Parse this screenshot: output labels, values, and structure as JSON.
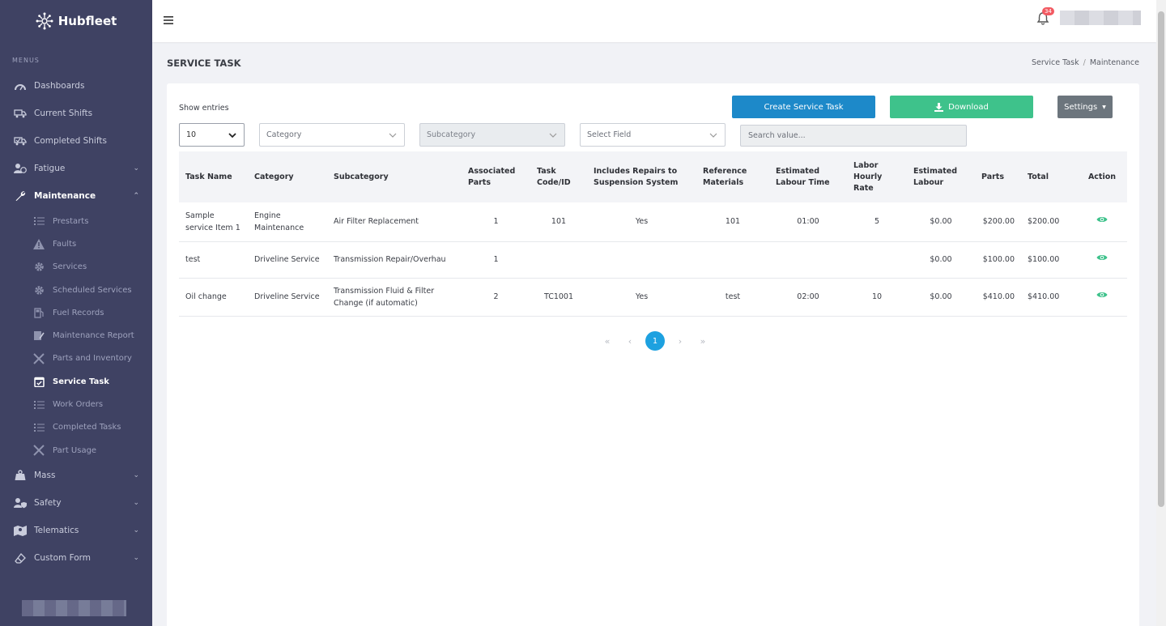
{
  "brand": {
    "name": "Hubfleet"
  },
  "sidebar": {
    "menu_title": "MENUS",
    "items": [
      {
        "label": "Dashboards"
      },
      {
        "label": "Current Shifts"
      },
      {
        "label": "Completed Shifts"
      },
      {
        "label": "Fatigue"
      },
      {
        "label": "Maintenance"
      },
      {
        "label": "Mass"
      },
      {
        "label": "Safety"
      },
      {
        "label": "Telematics"
      },
      {
        "label": "Custom Form"
      }
    ],
    "maintenance_sub": [
      {
        "label": "Prestarts"
      },
      {
        "label": "Faults"
      },
      {
        "label": "Services"
      },
      {
        "label": "Scheduled Services"
      },
      {
        "label": "Fuel Records"
      },
      {
        "label": "Maintenance Report"
      },
      {
        "label": "Parts and Inventory"
      },
      {
        "label": "Service Task"
      },
      {
        "label": "Work Orders"
      },
      {
        "label": "Completed Tasks"
      },
      {
        "label": "Part Usage"
      }
    ]
  },
  "topbar": {
    "notification_count": "34"
  },
  "page": {
    "title": "SERVICE TASK",
    "breadcrumb": [
      "Service Task",
      "Maintenance"
    ]
  },
  "controls": {
    "show_entries": "Show entries",
    "entries_value": "10",
    "category_placeholder": "Category",
    "subcategory_placeholder": "Subcategory",
    "field_placeholder": "Select Field",
    "search_placeholder": "Search value...",
    "create_label": "Create Service Task",
    "download_label": "Download",
    "settings_label": "Settings"
  },
  "table": {
    "headers": [
      "Task Name",
      "Category",
      "Subcategory",
      "Associated Parts",
      "Task Code/ID",
      "Includes Repairs to Suspension System",
      "Reference Materials",
      "Estimated Labour Time",
      "Labor Hourly Rate",
      "Estimated Labour",
      "Parts",
      "Total",
      "Action"
    ],
    "rows": [
      [
        "Sample service Item 1",
        "Engine Maintenance",
        "Air Filter Replacement",
        "1",
        "101",
        "Yes",
        "101",
        "01:00",
        "5",
        "$0.00",
        "$200.00",
        "$200.00"
      ],
      [
        "test",
        "Driveline Service",
        "Transmission Repair/Overhau",
        "1",
        "",
        "",
        "",
        "",
        "",
        "$0.00",
        "$100.00",
        "$100.00"
      ],
      [
        "Oil change",
        "Driveline Service",
        "Transmission Fluid & Filter Change (if automatic)",
        "2",
        "TC1001",
        "Yes",
        "test",
        "02:00",
        "10",
        "$0.00",
        "$410.00",
        "$410.00"
      ]
    ]
  },
  "pagination": {
    "first": "«",
    "prev": "‹",
    "current": "1",
    "next": "›",
    "last": "»"
  },
  "colors": {
    "sidebar": "#3f4263",
    "primary": "#1d89c9",
    "success": "#3ec28b",
    "secondary": "#6c757d",
    "badge": "#f25961",
    "action_icon": "#3ec28b"
  }
}
